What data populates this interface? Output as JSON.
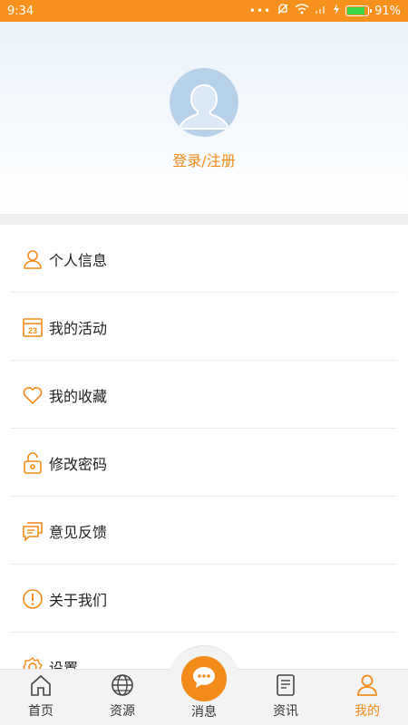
{
  "status_bar": {
    "time": "9:34",
    "battery_text": "91%",
    "battery_level": 0.91
  },
  "profile": {
    "login_label": "登录/注册",
    "avatar_icon": "default-avatar-icon"
  },
  "menu": {
    "items": [
      {
        "label": "个人信息",
        "icon": "person-icon"
      },
      {
        "label": "我的活动",
        "icon": "calendar-icon",
        "icon_text": "23"
      },
      {
        "label": "我的收藏",
        "icon": "heart-icon"
      },
      {
        "label": "修改密码",
        "icon": "unlock-icon"
      },
      {
        "label": "意见反馈",
        "icon": "chat-bubbles-icon"
      },
      {
        "label": "关于我们",
        "icon": "info-circle-icon"
      },
      {
        "label": "设置",
        "icon": "gear-icon"
      }
    ]
  },
  "bottom_nav": {
    "tabs": [
      {
        "label": "首页",
        "icon": "home-icon"
      },
      {
        "label": "资源",
        "icon": "globe-icon"
      },
      {
        "label": "消息",
        "icon": "message-icon"
      },
      {
        "label": "资讯",
        "icon": "news-icon"
      },
      {
        "label": "我的",
        "icon": "person-icon",
        "active": true
      }
    ]
  },
  "colors": {
    "accent": "#f28b1a",
    "status_bar": "#f6911e",
    "avatar": "#b8d1ea"
  }
}
